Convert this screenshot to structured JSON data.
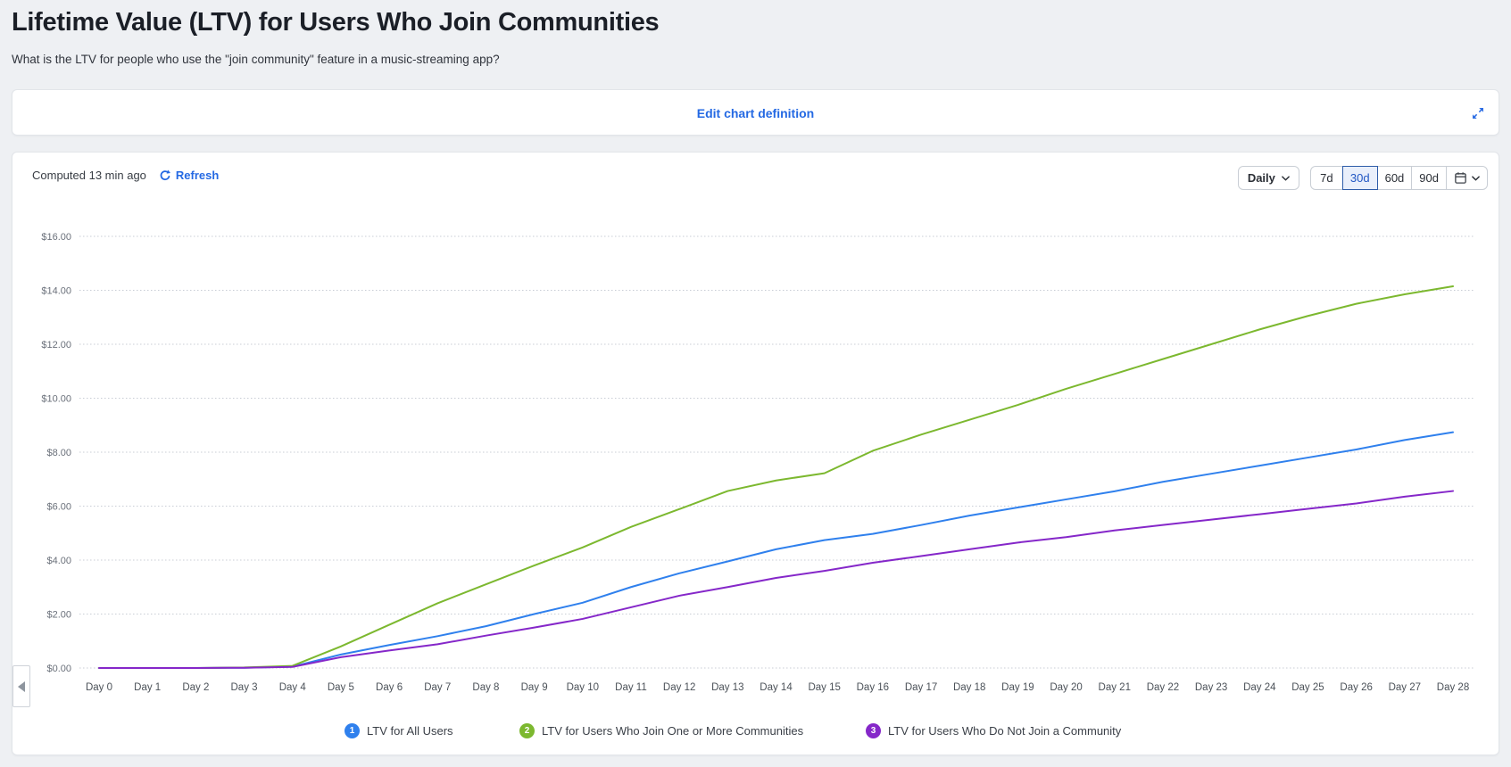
{
  "page": {
    "title": "Lifetime Value (LTV) for Users Who Join Communities",
    "subtitle": "What is the LTV for people who use the \"join community\" feature in a music-streaming app?"
  },
  "definition_bar": {
    "edit_link": "Edit chart definition",
    "expand_icon": "expand-diagonal-arrows"
  },
  "toolbar": {
    "computed_text": "Computed 13 min ago",
    "refresh_label": "Refresh",
    "refresh_icon": "circular-arrows",
    "granularity_label": "Daily",
    "range_options": [
      "7d",
      "30d",
      "60d",
      "90d"
    ],
    "selected_range": "30d",
    "calendar_icon": "calendar"
  },
  "colors": {
    "link_blue": "#2469e3",
    "series_blue": "#2f80ed",
    "series_green": "#7cb82f",
    "series_purple": "#8527c9",
    "selected_range_bg": "#e9effb",
    "selected_range_border": "#2e5ca9",
    "gridline": "#c8cdd5"
  },
  "chart_data": {
    "type": "line",
    "categories": [
      "Day 0",
      "Day 1",
      "Day 2",
      "Day 3",
      "Day 4",
      "Day 5",
      "Day 6",
      "Day 7",
      "Day 8",
      "Day 9",
      "Day 10",
      "Day 11",
      "Day 12",
      "Day 13",
      "Day 14",
      "Day 15",
      "Day 16",
      "Day 17",
      "Day 18",
      "Day 19",
      "Day 20",
      "Day 21",
      "Day 22",
      "Day 23",
      "Day 24",
      "Day 25",
      "Day 26",
      "Day 27",
      "Day 28"
    ],
    "series": [
      {
        "badge": "1",
        "name": "LTV for All Users",
        "color": "#2f80ed",
        "values": [
          0,
          0,
          0,
          0.01,
          0.05,
          0.5,
          0.85,
          1.18,
          1.55,
          2.0,
          2.42,
          3.0,
          3.51,
          3.95,
          4.4,
          4.74,
          4.97,
          5.3,
          5.65,
          5.95,
          6.25,
          6.55,
          6.9,
          7.2,
          7.5,
          7.8,
          8.1,
          8.45,
          8.74
        ]
      },
      {
        "badge": "2",
        "name": "LTV for Users Who Join One or More Communities",
        "color": "#7cb82f",
        "values": [
          0,
          0,
          0,
          0.02,
          0.08,
          0.8,
          1.6,
          2.4,
          3.1,
          3.8,
          4.47,
          5.23,
          5.89,
          6.56,
          6.95,
          7.22,
          8.05,
          8.65,
          9.2,
          9.75,
          10.35,
          10.9,
          11.45,
          12.0,
          12.55,
          13.05,
          13.5,
          13.85,
          14.15
        ]
      },
      {
        "badge": "3",
        "name": "LTV for Users Who Do Not Join a Community",
        "color": "#8527c9",
        "values": [
          0,
          0,
          0,
          0.01,
          0.04,
          0.4,
          0.65,
          0.88,
          1.2,
          1.5,
          1.82,
          2.25,
          2.68,
          3.0,
          3.34,
          3.6,
          3.9,
          4.15,
          4.4,
          4.65,
          4.85,
          5.1,
          5.3,
          5.5,
          5.7,
          5.9,
          6.1,
          6.35,
          6.56
        ]
      }
    ],
    "title": "",
    "xlabel": "",
    "ylabel": "",
    "ylim": [
      0,
      16
    ],
    "ytick_step": 2,
    "ytick_format": "$%.2f",
    "grid": "dotted-horizontal",
    "legend_position": "bottom"
  }
}
